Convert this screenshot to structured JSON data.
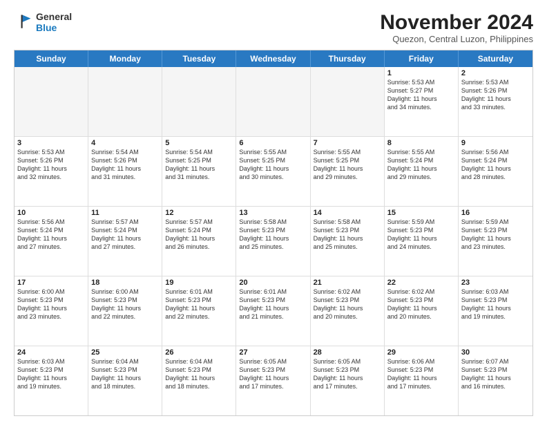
{
  "logo": {
    "line1": "General",
    "line2": "Blue"
  },
  "title": "November 2024",
  "subtitle": "Quezon, Central Luzon, Philippines",
  "weekdays": [
    "Sunday",
    "Monday",
    "Tuesday",
    "Wednesday",
    "Thursday",
    "Friday",
    "Saturday"
  ],
  "weeks": [
    [
      {
        "day": "",
        "info": "",
        "empty": true
      },
      {
        "day": "",
        "info": "",
        "empty": true
      },
      {
        "day": "",
        "info": "",
        "empty": true
      },
      {
        "day": "",
        "info": "",
        "empty": true
      },
      {
        "day": "",
        "info": "",
        "empty": true
      },
      {
        "day": "1",
        "info": "Sunrise: 5:53 AM\nSunset: 5:27 PM\nDaylight: 11 hours\nand 34 minutes.",
        "empty": false
      },
      {
        "day": "2",
        "info": "Sunrise: 5:53 AM\nSunset: 5:26 PM\nDaylight: 11 hours\nand 33 minutes.",
        "empty": false
      }
    ],
    [
      {
        "day": "3",
        "info": "Sunrise: 5:53 AM\nSunset: 5:26 PM\nDaylight: 11 hours\nand 32 minutes.",
        "empty": false
      },
      {
        "day": "4",
        "info": "Sunrise: 5:54 AM\nSunset: 5:26 PM\nDaylight: 11 hours\nand 31 minutes.",
        "empty": false
      },
      {
        "day": "5",
        "info": "Sunrise: 5:54 AM\nSunset: 5:25 PM\nDaylight: 11 hours\nand 31 minutes.",
        "empty": false
      },
      {
        "day": "6",
        "info": "Sunrise: 5:55 AM\nSunset: 5:25 PM\nDaylight: 11 hours\nand 30 minutes.",
        "empty": false
      },
      {
        "day": "7",
        "info": "Sunrise: 5:55 AM\nSunset: 5:25 PM\nDaylight: 11 hours\nand 29 minutes.",
        "empty": false
      },
      {
        "day": "8",
        "info": "Sunrise: 5:55 AM\nSunset: 5:24 PM\nDaylight: 11 hours\nand 29 minutes.",
        "empty": false
      },
      {
        "day": "9",
        "info": "Sunrise: 5:56 AM\nSunset: 5:24 PM\nDaylight: 11 hours\nand 28 minutes.",
        "empty": false
      }
    ],
    [
      {
        "day": "10",
        "info": "Sunrise: 5:56 AM\nSunset: 5:24 PM\nDaylight: 11 hours\nand 27 minutes.",
        "empty": false
      },
      {
        "day": "11",
        "info": "Sunrise: 5:57 AM\nSunset: 5:24 PM\nDaylight: 11 hours\nand 27 minutes.",
        "empty": false
      },
      {
        "day": "12",
        "info": "Sunrise: 5:57 AM\nSunset: 5:24 PM\nDaylight: 11 hours\nand 26 minutes.",
        "empty": false
      },
      {
        "day": "13",
        "info": "Sunrise: 5:58 AM\nSunset: 5:23 PM\nDaylight: 11 hours\nand 25 minutes.",
        "empty": false
      },
      {
        "day": "14",
        "info": "Sunrise: 5:58 AM\nSunset: 5:23 PM\nDaylight: 11 hours\nand 25 minutes.",
        "empty": false
      },
      {
        "day": "15",
        "info": "Sunrise: 5:59 AM\nSunset: 5:23 PM\nDaylight: 11 hours\nand 24 minutes.",
        "empty": false
      },
      {
        "day": "16",
        "info": "Sunrise: 5:59 AM\nSunset: 5:23 PM\nDaylight: 11 hours\nand 23 minutes.",
        "empty": false
      }
    ],
    [
      {
        "day": "17",
        "info": "Sunrise: 6:00 AM\nSunset: 5:23 PM\nDaylight: 11 hours\nand 23 minutes.",
        "empty": false
      },
      {
        "day": "18",
        "info": "Sunrise: 6:00 AM\nSunset: 5:23 PM\nDaylight: 11 hours\nand 22 minutes.",
        "empty": false
      },
      {
        "day": "19",
        "info": "Sunrise: 6:01 AM\nSunset: 5:23 PM\nDaylight: 11 hours\nand 22 minutes.",
        "empty": false
      },
      {
        "day": "20",
        "info": "Sunrise: 6:01 AM\nSunset: 5:23 PM\nDaylight: 11 hours\nand 21 minutes.",
        "empty": false
      },
      {
        "day": "21",
        "info": "Sunrise: 6:02 AM\nSunset: 5:23 PM\nDaylight: 11 hours\nand 20 minutes.",
        "empty": false
      },
      {
        "day": "22",
        "info": "Sunrise: 6:02 AM\nSunset: 5:23 PM\nDaylight: 11 hours\nand 20 minutes.",
        "empty": false
      },
      {
        "day": "23",
        "info": "Sunrise: 6:03 AM\nSunset: 5:23 PM\nDaylight: 11 hours\nand 19 minutes.",
        "empty": false
      }
    ],
    [
      {
        "day": "24",
        "info": "Sunrise: 6:03 AM\nSunset: 5:23 PM\nDaylight: 11 hours\nand 19 minutes.",
        "empty": false
      },
      {
        "day": "25",
        "info": "Sunrise: 6:04 AM\nSunset: 5:23 PM\nDaylight: 11 hours\nand 18 minutes.",
        "empty": false
      },
      {
        "day": "26",
        "info": "Sunrise: 6:04 AM\nSunset: 5:23 PM\nDaylight: 11 hours\nand 18 minutes.",
        "empty": false
      },
      {
        "day": "27",
        "info": "Sunrise: 6:05 AM\nSunset: 5:23 PM\nDaylight: 11 hours\nand 17 minutes.",
        "empty": false
      },
      {
        "day": "28",
        "info": "Sunrise: 6:05 AM\nSunset: 5:23 PM\nDaylight: 11 hours\nand 17 minutes.",
        "empty": false
      },
      {
        "day": "29",
        "info": "Sunrise: 6:06 AM\nSunset: 5:23 PM\nDaylight: 11 hours\nand 17 minutes.",
        "empty": false
      },
      {
        "day": "30",
        "info": "Sunrise: 6:07 AM\nSunset: 5:23 PM\nDaylight: 11 hours\nand 16 minutes.",
        "empty": false
      }
    ]
  ]
}
